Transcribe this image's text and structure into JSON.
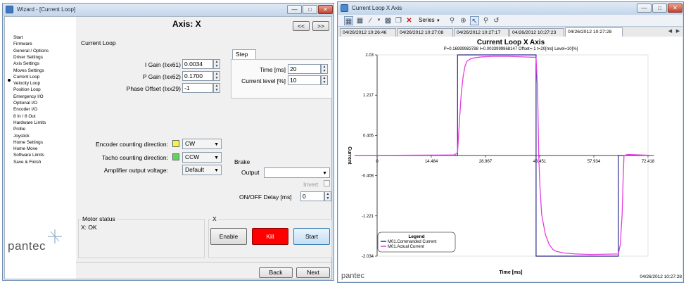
{
  "wizard": {
    "title": "Wizard - [Current Loop]",
    "heading": "Axis: X",
    "prev_label": "<<",
    "next_nav_label": ">>",
    "nav_items": [
      "Start",
      "Firmware",
      "General / Options",
      "Driver Settings",
      "Axis Settings",
      "Moves Settings",
      "Current Loop",
      "Velocity Loop",
      "Position Loop",
      "Emergency I/O",
      "Optional I/O",
      "Encoder I/O",
      "8 In / 8 Out",
      "Hardware Limits",
      "Probe",
      "Joystick",
      "Home Settings",
      "Home Move",
      "Software Limits",
      "Save & Finish"
    ],
    "active_nav": "Current Loop",
    "logo_text": "pantec",
    "current_loop": {
      "group_label": "Current Loop",
      "i_gain_label": "I Gain (Ixx61)",
      "i_gain_value": "0.0034",
      "p_gain_label": "P Gain (Ixx62)",
      "p_gain_value": "0.1700",
      "phase_offset_label": "Phase Offset (Ixx29)",
      "phase_offset_value": "-1"
    },
    "step": {
      "tab_label": "Step",
      "time_label": "Time [ms]",
      "time_value": "20",
      "level_label": "Current level [%]",
      "level_value": "10"
    },
    "encoder_dir_label": "Encoder counting direction:",
    "encoder_dir_value": "CW",
    "encoder_color": "#f5f542",
    "tacho_dir_label": "Tacho counting direction:",
    "tacho_dir_value": "CCW",
    "tacho_color": "#5fd35f",
    "amp_voltage_label": "Amplifier output voltage:",
    "amp_voltage_value": "Default",
    "brake": {
      "group_label": "Brake",
      "output_label": "Output",
      "output_value": "",
      "invert_label": "Invert",
      "onoff_label": "ON/OFF Delay [ms]",
      "onoff_value": "0"
    },
    "motor_status": {
      "group_label": "Motor status",
      "status_text": "X: OK"
    },
    "axis_group": {
      "label": "X",
      "enable_label": "Enable",
      "kill_label": "Kill",
      "start_label": "Start",
      "kill_color": "#ff0000"
    },
    "back_label": "Back",
    "next_label": "Next"
  },
  "plot_window": {
    "title": "Current Loop X Axis",
    "toolbar": {
      "series_label": "Series"
    },
    "tabs": [
      "04/26/2012 10:26:46",
      "04/26/2012 10:27:08",
      "04/26/2012 10:27:17",
      "04/26/2012 10:27:23",
      "04/26/2012 10:27:28"
    ],
    "active_tab": "04/26/2012 10:27:28",
    "logo_text": "pantec",
    "timestamp": "04/26/2012 10:27:28"
  },
  "chart_data": {
    "type": "line",
    "title": "Current Loop X Axis",
    "subtitle": "P=0.16999983788 I=0.0033999868147 Offset=-1 t=20[ms] Level=10[%]",
    "xlabel": "Time [ms]",
    "ylabel": "Current",
    "xlim": [
      0,
      72.418
    ],
    "ylim": [
      -2.034,
      2.03
    ],
    "x_ticks": [
      "0",
      "14.484",
      "28.967",
      "43.451",
      "57.934",
      "72.418"
    ],
    "y_ticks": [
      "2.03",
      "1.217",
      "0.405",
      "-0.408",
      "-1.221",
      "-2.034"
    ],
    "legend": {
      "title": "Legend",
      "placement": "bottom-left",
      "entries": [
        "M01.Commanded Current",
        "M01.Actual Current"
      ]
    },
    "series": [
      {
        "name": "M01.Commanded Current",
        "color": "#2b2b8c",
        "x": [
          -6,
          21.5,
          21.5,
          42.5,
          42.5,
          64.5,
          64.5,
          74
        ],
        "values": [
          0,
          0,
          2.03,
          2.03,
          -2.034,
          -2.034,
          0,
          0
        ]
      },
      {
        "name": "M01.Actual Current",
        "color": "#e23ee2",
        "x": [
          -6,
          20.5,
          21.5,
          22,
          22.5,
          23,
          23.5,
          24,
          25,
          26,
          28,
          31,
          35,
          42.5,
          42.9,
          43.2,
          43.5,
          44,
          45,
          46,
          47,
          48,
          50,
          53,
          57,
          64.5,
          65,
          65.5,
          65.8,
          66,
          67,
          74
        ],
        "values": [
          0,
          0.01,
          0.05,
          0.7,
          1.25,
          1.6,
          1.8,
          1.9,
          1.95,
          1.97,
          1.99,
          2.0,
          2.0,
          1.98,
          1.3,
          0,
          -0.6,
          -1.2,
          -1.6,
          -1.8,
          -1.9,
          -1.94,
          -1.97,
          -1.99,
          -2.0,
          -1.99,
          -1.8,
          -1.2,
          -0.4,
          0,
          0.02,
          0
        ]
      }
    ]
  }
}
